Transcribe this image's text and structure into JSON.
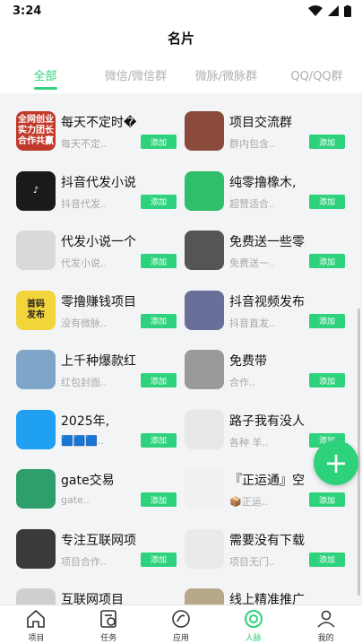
{
  "status": {
    "time": "3:24"
  },
  "header": {
    "title": "名片"
  },
  "tabs": [
    {
      "label": "全部",
      "active": true
    },
    {
      "label": "微信/微信群",
      "active": false
    },
    {
      "label": "微脉/微脉群",
      "active": false
    },
    {
      "label": "QQ/QQ群",
      "active": false
    }
  ],
  "add_label": "添加",
  "cards": [
    {
      "title": "每天不定时�",
      "subtitle": "每天不定..",
      "avatar_text": "全网创业\n实力团长\n合作共赢",
      "avatar_color": "#c0392b"
    },
    {
      "title": "项目交流群",
      "subtitle": "群内包含..",
      "avatar_text": "",
      "avatar_color": "#8a4b3c"
    },
    {
      "title": "抖音代发小说",
      "subtitle": "抖音代发..",
      "avatar_text": "♪",
      "avatar_color": "#1a1a1a"
    },
    {
      "title": "纯零撸橡木,",
      "subtitle": "超赞适合..",
      "avatar_text": "",
      "avatar_color": "#2fbf6a"
    },
    {
      "title": "代发小说一个",
      "subtitle": "代发小说..",
      "avatar_text": "",
      "avatar_color": "#d9d9d9"
    },
    {
      "title": "免费送一些零",
      "subtitle": "免费送一..",
      "avatar_text": "",
      "avatar_color": "#555555"
    },
    {
      "title": "零撸赚钱项目",
      "subtitle": "没有微脉..",
      "avatar_text": "首码\n发布",
      "avatar_color": "#f2d43b"
    },
    {
      "title": "抖音视频发布",
      "subtitle": "抖音直发..",
      "avatar_text": "",
      "avatar_color": "#6a6f9a"
    },
    {
      "title": "上千种爆款红",
      "subtitle": "红包封面..",
      "avatar_text": "",
      "avatar_color": "#7fa6c9"
    },
    {
      "title": "免费带",
      "subtitle": "合作..",
      "avatar_text": "",
      "avatar_color": "#9a9a9a"
    },
    {
      "title": "2025年,",
      "subtitle": "🟦🟦🟦..",
      "avatar_text": "",
      "avatar_color": "#1fa0f0"
    },
    {
      "title": "路子我有没人",
      "subtitle": "各种 羊..",
      "avatar_text": "",
      "avatar_color": "#e8e8e8"
    },
    {
      "title": "gate交易",
      "subtitle": "gate..",
      "avatar_text": "",
      "avatar_color": "#2e9e6a"
    },
    {
      "title": "『正运通』空",
      "subtitle": "📦正运..",
      "avatar_text": "",
      "avatar_color": "#f0f0f0"
    },
    {
      "title": "专注互联网项",
      "subtitle": "项目合作..",
      "avatar_text": "",
      "avatar_color": "#3a3a3a"
    },
    {
      "title": "需要没有下载",
      "subtitle": "项目无门..",
      "avatar_text": "",
      "avatar_color": "#eaeaea"
    },
    {
      "title": "互联网项目",
      "subtitle": "",
      "avatar_text": "",
      "avatar_color": "#cfcfcf"
    },
    {
      "title": "线上精准推广",
      "subtitle": "",
      "avatar_text": "",
      "avatar_color": "#b8a88a"
    }
  ],
  "fab": {
    "label": "+"
  },
  "bottom_nav": [
    {
      "label": "项目",
      "icon": "home-icon",
      "active": false
    },
    {
      "label": "任务",
      "icon": "task-icon",
      "active": false
    },
    {
      "label": "应用",
      "icon": "apps-icon",
      "active": false
    },
    {
      "label": "人脉",
      "icon": "contacts-icon",
      "active": true
    },
    {
      "label": "我的",
      "icon": "profile-icon",
      "active": false
    }
  ]
}
